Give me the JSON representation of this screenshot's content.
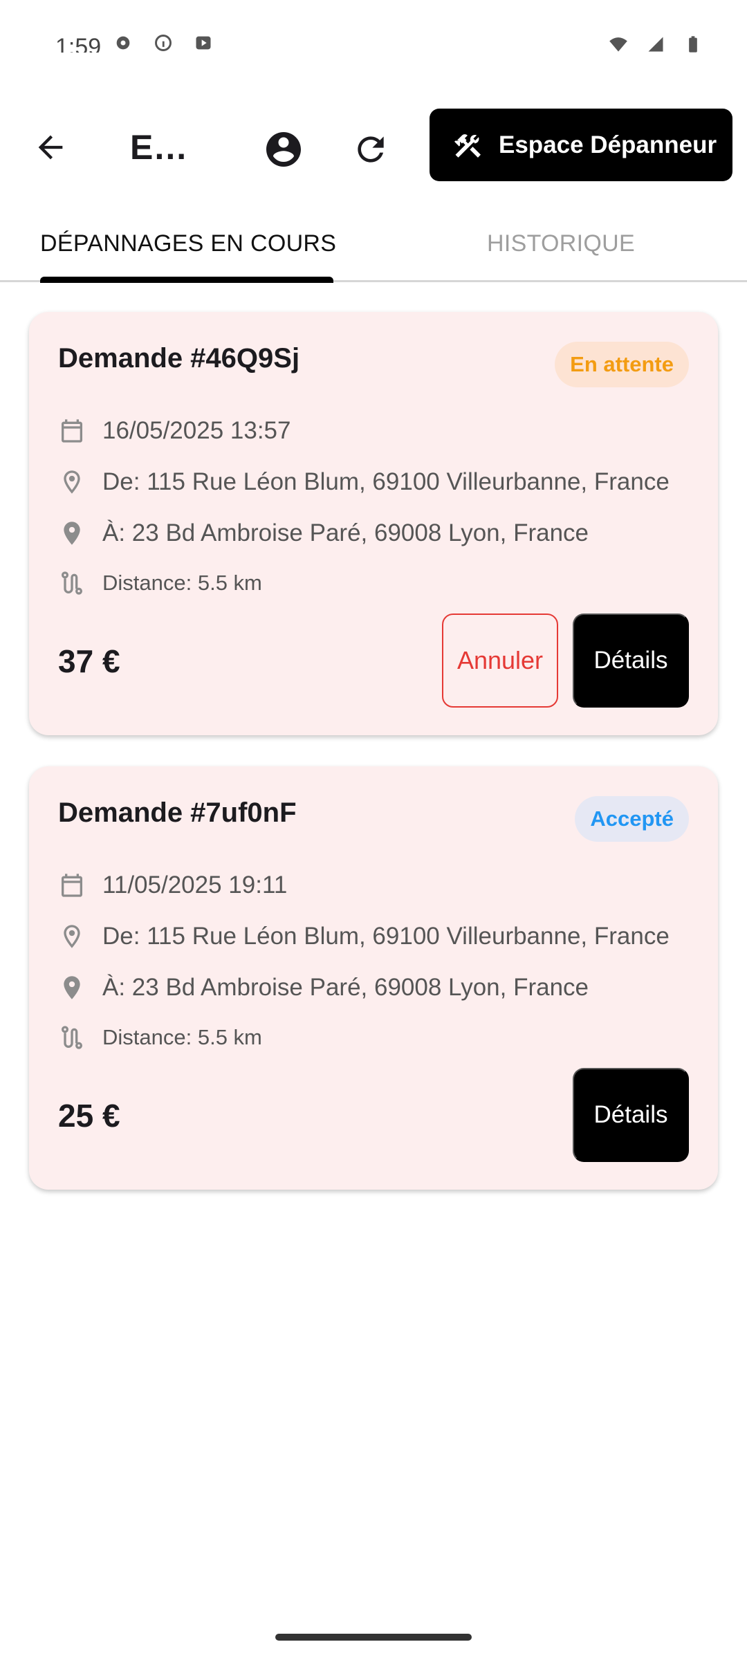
{
  "status_bar": {
    "time": "1:59",
    "left_icons": [
      "settings-icon",
      "info-icon",
      "media-icon"
    ],
    "right_icons": [
      "wifi-icon",
      "signal-icon",
      "battery-icon"
    ]
  },
  "app_bar": {
    "title": "Es…",
    "back_icon": "arrow-back-icon",
    "profile_icon": "account-circle-icon",
    "refresh_icon": "refresh-icon",
    "espace_button_label": "Espace Dépanneur",
    "espace_button_icon": "tools-icon"
  },
  "tabs": [
    {
      "label": "DÉPANNAGES EN COURS",
      "active": true
    },
    {
      "label": "HISTORIQUE",
      "active": false
    }
  ],
  "requests": [
    {
      "title": "Demande #46Q9Sj",
      "status": "En attente",
      "date": "16/05/2025 13:57",
      "from": "De: 115 Rue Léon Blum, 69100 Villeurbanne, France",
      "to": "À: 23 Bd Ambroise Paré, 69008 Lyon, France",
      "distance": "Distance: 5.5 km",
      "price": "37 €",
      "cancel_label": "Annuler",
      "details_label": "Détails"
    },
    {
      "title": "Demande #7uf0nF",
      "status": "Accepté",
      "date": "11/05/2025 19:11",
      "from": "De: 115 Rue Léon Blum, 69100 Villeurbanne, France",
      "to": "À: 23 Bd Ambroise Paré, 69008 Lyon, France",
      "distance": "Distance: 5.5 km",
      "price": "25 €",
      "details_label": "Détails"
    }
  ],
  "colors": {
    "card_background": "#fdeeee",
    "pending_text": "#f39c12",
    "accepted_text": "#2196f3",
    "cancel_red": "#e53935",
    "primary_black": "#000000"
  }
}
